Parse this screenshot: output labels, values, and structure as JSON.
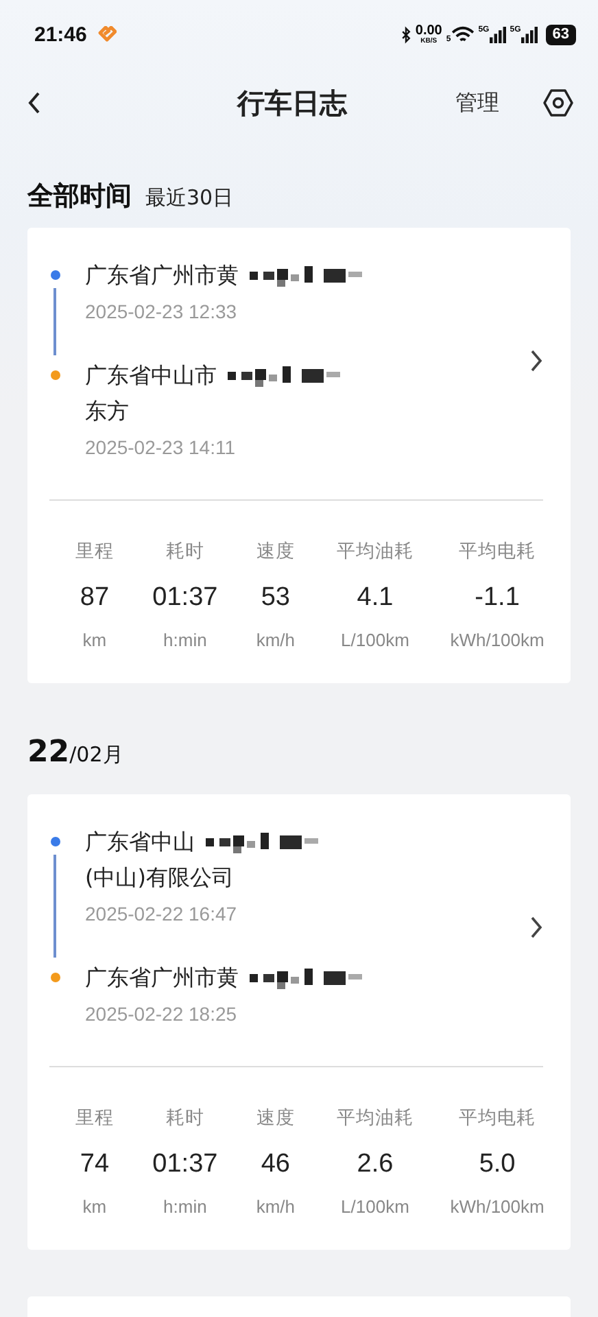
{
  "status_bar": {
    "time": "21:46",
    "net_speed": "0.00",
    "net_unit": "KB/S",
    "wifi_label": "5",
    "signals": [
      {
        "label": "5G"
      },
      {
        "label": "5G"
      }
    ],
    "battery": "63"
  },
  "header": {
    "title": "行车日志",
    "action": "管理"
  },
  "filter": {
    "tabs": [
      {
        "label": "全部时间",
        "selected": true
      },
      {
        "label": "最近30日",
        "selected": false
      }
    ]
  },
  "trips": [
    {
      "points": [
        {
          "color": "#3a7be8",
          "lines": [
            "广东省广州市黄"
          ],
          "masked": true,
          "time": "2025-02-23 12:33"
        },
        {
          "color": "#f39a1c",
          "lines": [
            "广东省中山市",
            "东方"
          ],
          "masked": true,
          "time": "2025-02-23 14:11"
        }
      ],
      "stats": [
        {
          "label": "里程",
          "value": "87",
          "unit": "km"
        },
        {
          "label": "耗时",
          "value": "01:37",
          "unit": "h:min"
        },
        {
          "label": "速度",
          "value": "53",
          "unit": "km/h"
        },
        {
          "label": "平均油耗",
          "value": "4.1",
          "unit": "L/100km"
        },
        {
          "label": "平均电耗",
          "value": "-1.1",
          "unit": "kWh/100km"
        }
      ]
    },
    {
      "date_header": {
        "day": "22",
        "month": "/02月"
      },
      "points": [
        {
          "color": "#3a7be8",
          "lines": [
            "广东省中山",
            "(中山)有限公司"
          ],
          "masked": true,
          "time": "2025-02-22 16:47"
        },
        {
          "color": "#f39a1c",
          "lines": [
            "广东省广州市黄"
          ],
          "masked": true,
          "time": "2025-02-22 18:25"
        }
      ],
      "stats": [
        {
          "label": "里程",
          "value": "74",
          "unit": "km"
        },
        {
          "label": "耗时",
          "value": "01:37",
          "unit": "h:min"
        },
        {
          "label": "速度",
          "value": "46",
          "unit": "km/h"
        },
        {
          "label": "平均油耗",
          "value": "2.6",
          "unit": "L/100km"
        },
        {
          "label": "平均电耗",
          "value": "5.0",
          "unit": "kWh/100km"
        }
      ]
    }
  ]
}
